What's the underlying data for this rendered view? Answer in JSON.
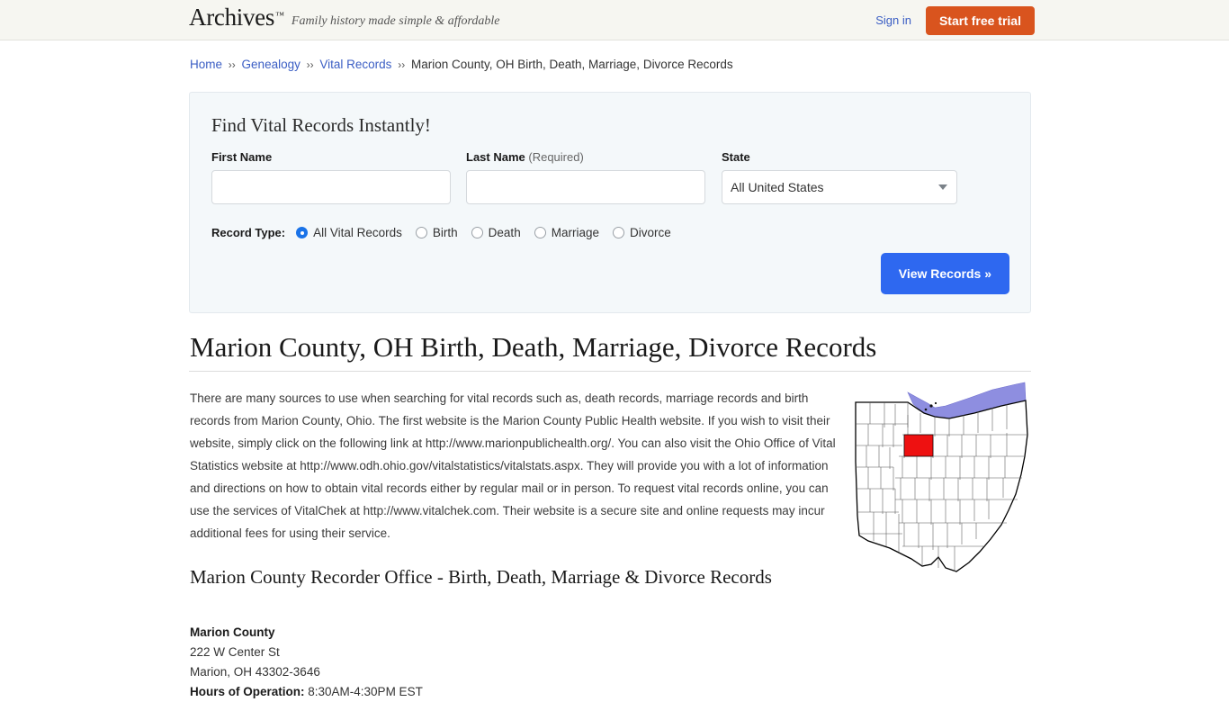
{
  "header": {
    "brand_name": "Archives",
    "brand_tm": "™",
    "tagline": "Family history made simple & affordable",
    "sign_in_label": "Sign in",
    "trial_button_label": "Start free trial",
    "brand_button_color": "#d9541e",
    "link_color": "#3b5ec4",
    "bar_background": "#f6f6f1"
  },
  "breadcrumb": {
    "separator": "››",
    "items": [
      {
        "label": "Home",
        "is_link": true
      },
      {
        "label": "Genealogy",
        "is_link": true
      },
      {
        "label": "Vital Records",
        "is_link": true
      },
      {
        "label": "Marion County, OH Birth, Death, Marriage, Divorce Records",
        "is_link": false
      }
    ]
  },
  "search_panel": {
    "title": "Find Vital Records Instantly!",
    "first_name": {
      "label": "First Name",
      "value": "",
      "placeholder": ""
    },
    "last_name": {
      "label": "Last Name",
      "required_note": "(Required)",
      "value": "",
      "placeholder": ""
    },
    "state": {
      "label": "State",
      "selected": "All United States",
      "options": [
        "All United States"
      ]
    },
    "record_type": {
      "label": "Record Type:",
      "selected": "All Vital Records",
      "options": [
        {
          "label": "All Vital Records",
          "checked": true
        },
        {
          "label": "Birth",
          "checked": false
        },
        {
          "label": "Death",
          "checked": false
        },
        {
          "label": "Marriage",
          "checked": false
        },
        {
          "label": "Divorce",
          "checked": false
        }
      ]
    },
    "submit_label": "View Records »",
    "submit_color": "#2e68f0",
    "panel_background": "#f4f8fa"
  },
  "main": {
    "page_title": "Marion County, OH Birth, Death, Marriage, Divorce Records",
    "intro_paragraph": "There are many sources to use when searching for vital records such as, death records, marriage records and birth records from Marion County, Ohio. The first website is the Marion County Public Health website. If you wish to visit their website, simply click on the following link at http://www.marionpublichealth.org/. You can also visit the Ohio Office of Vital Statistics website at http://www.odh.ohio.gov/vitalstatistics/vitalstats.aspx. They will provide you with a lot of information and directions on how to obtain vital records either by regular mail or in person. To request vital records online, you can use the services of VitalChek at http://www.vitalchek.com. Their website is a secure site and online requests may incur additional fees for using their service.",
    "section_heading": "Marion County Recorder Office - Birth, Death, Marriage & Divorce Records",
    "office": {
      "name": "Marion County",
      "street": "222 W Center St",
      "city_state_zip": "Marion, OH 43302-3646",
      "hours_label": "Hours of Operation:",
      "hours_value": "8:30AM-4:30PM EST"
    },
    "map": {
      "alt": "Map of Ohio highlighting Marion County",
      "highlight_color": "#ee1111",
      "water_color": "#8e8ee0",
      "outline_color": "#000000"
    }
  }
}
